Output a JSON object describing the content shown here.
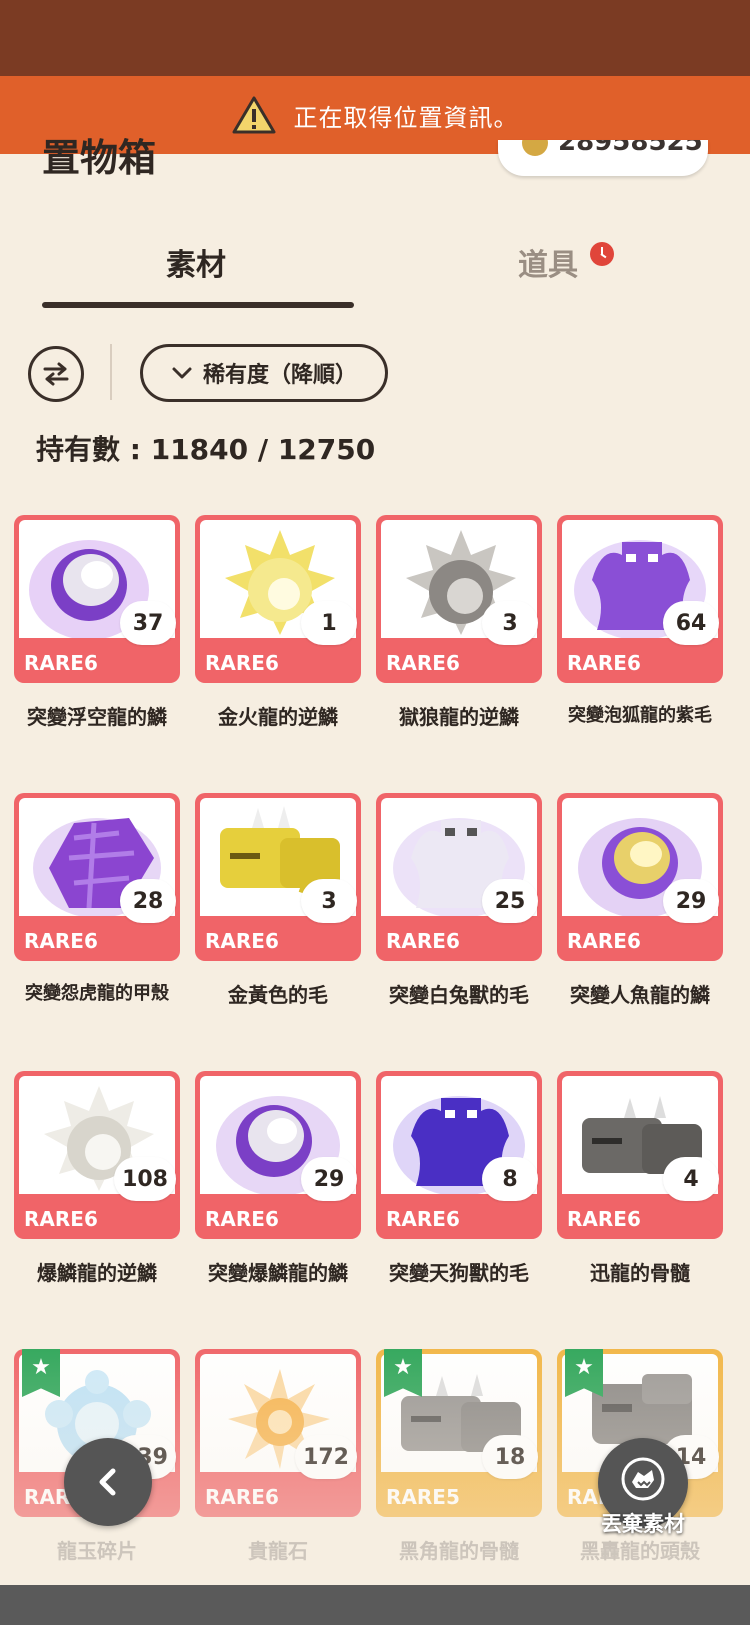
{
  "alert": {
    "text": "正在取得位置資訊。",
    "icon": "warning-icon"
  },
  "header": {
    "title": "置物箱",
    "coins": "28958525"
  },
  "tabs": [
    {
      "label": "素材",
      "active": true
    },
    {
      "label": "道具",
      "active": false,
      "badge": "clock-icon"
    }
  ],
  "toolbar": {
    "sort_label": "稀有度（降順）"
  },
  "summary": {
    "count": "持有數 : 11840 / 12750"
  },
  "items": [
    {
      "name": "突變浮空龍的鱗",
      "qty": "37",
      "rarity": "RARE6"
    },
    {
      "name": "金火龍的逆鱗",
      "qty": "1",
      "rarity": "RARE6"
    },
    {
      "name": "獄狼龍的逆鱗",
      "qty": "3",
      "rarity": "RARE6"
    },
    {
      "name": "突變泡狐龍的紫毛",
      "qty": "64",
      "rarity": "RARE6"
    },
    {
      "name": "突變怨虎龍的甲殼",
      "qty": "28",
      "rarity": "RARE6"
    },
    {
      "name": "金黃色的毛",
      "qty": "3",
      "rarity": "RARE6"
    },
    {
      "name": "突變白兔獸的毛",
      "qty": "25",
      "rarity": "RARE6"
    },
    {
      "name": "突變人魚龍的鱗",
      "qty": "29",
      "rarity": "RARE6"
    },
    {
      "name": "爆鱗龍的逆鱗",
      "qty": "108",
      "rarity": "RARE6"
    },
    {
      "name": "突變爆鱗龍的鱗",
      "qty": "29",
      "rarity": "RARE6"
    },
    {
      "name": "突變天狗獸的毛",
      "qty": "8",
      "rarity": "RARE6"
    },
    {
      "name": "迅龍的骨髓",
      "qty": "4",
      "rarity": "RARE6"
    },
    {
      "name": "龍玉碎片",
      "qty": "139",
      "rarity": "RARE6"
    },
    {
      "name": "貴龍石",
      "qty": "172",
      "rarity": "RARE6"
    },
    {
      "name": "黑角龍的骨髓",
      "qty": "18",
      "rarity": "RARE5"
    },
    {
      "name": "黑轟龍的頭殼",
      "qty": "14",
      "rarity": "RARE5"
    }
  ],
  "buttons": {
    "back": "chevron-left-icon",
    "discard_label": "丟棄素材"
  },
  "colors": {
    "status_bar": "#7b3b23",
    "alert": "#e0602a",
    "rare6": "#f06468",
    "rare5": "#f2b646",
    "star": "#2fa65a"
  }
}
